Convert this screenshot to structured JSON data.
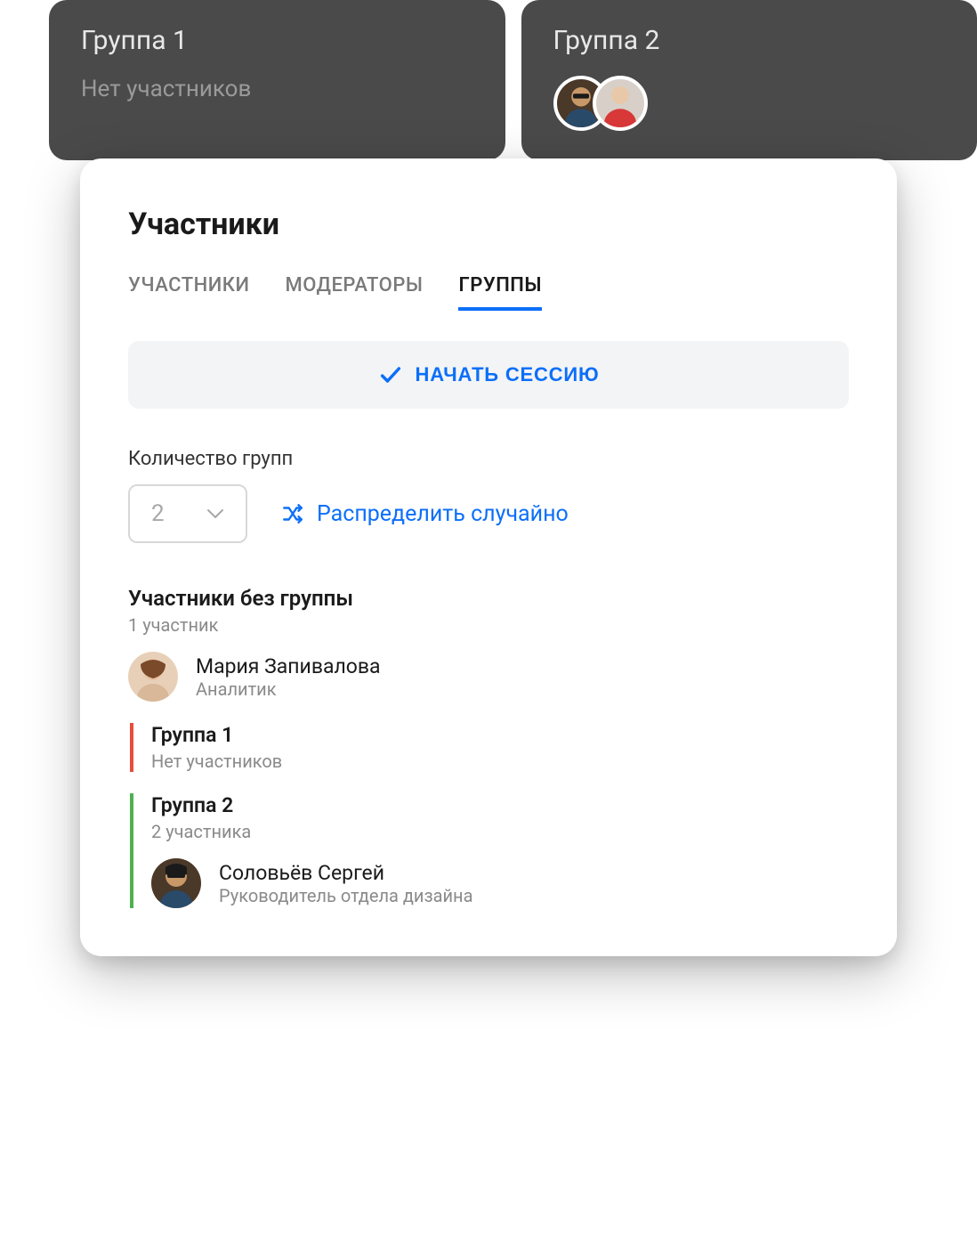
{
  "topGroups": {
    "group1": {
      "title": "Группа 1",
      "subtitle": "Нет участников"
    },
    "group2": {
      "title": "Группа 2"
    }
  },
  "panel": {
    "title": "Участники",
    "tabs": {
      "participants": "УЧАСТНИКИ",
      "moderators": "МОДЕРАТОРЫ",
      "groups": "ГРУППЫ"
    },
    "startSession": "НАЧАТЬ СЕССИЮ",
    "groupCount": {
      "label": "Количество групп",
      "value": "2"
    },
    "shuffle": "Распределить случайно",
    "ungrouped": {
      "title": "Участники без группы",
      "subtitle": "1 участник",
      "member": {
        "name": "Мария Запивалова",
        "role": "Аналитик"
      }
    },
    "group1": {
      "title": "Группа 1",
      "subtitle": "Нет участников"
    },
    "group2": {
      "title": "Группа 2",
      "subtitle": "2 участника",
      "member": {
        "name": "Соловьёв Сергей",
        "role": "Руководитель отдела дизайна"
      }
    }
  },
  "colors": {
    "accent": "#0c6ff9",
    "red": "#e74c3c",
    "green": "#4fb04f"
  }
}
